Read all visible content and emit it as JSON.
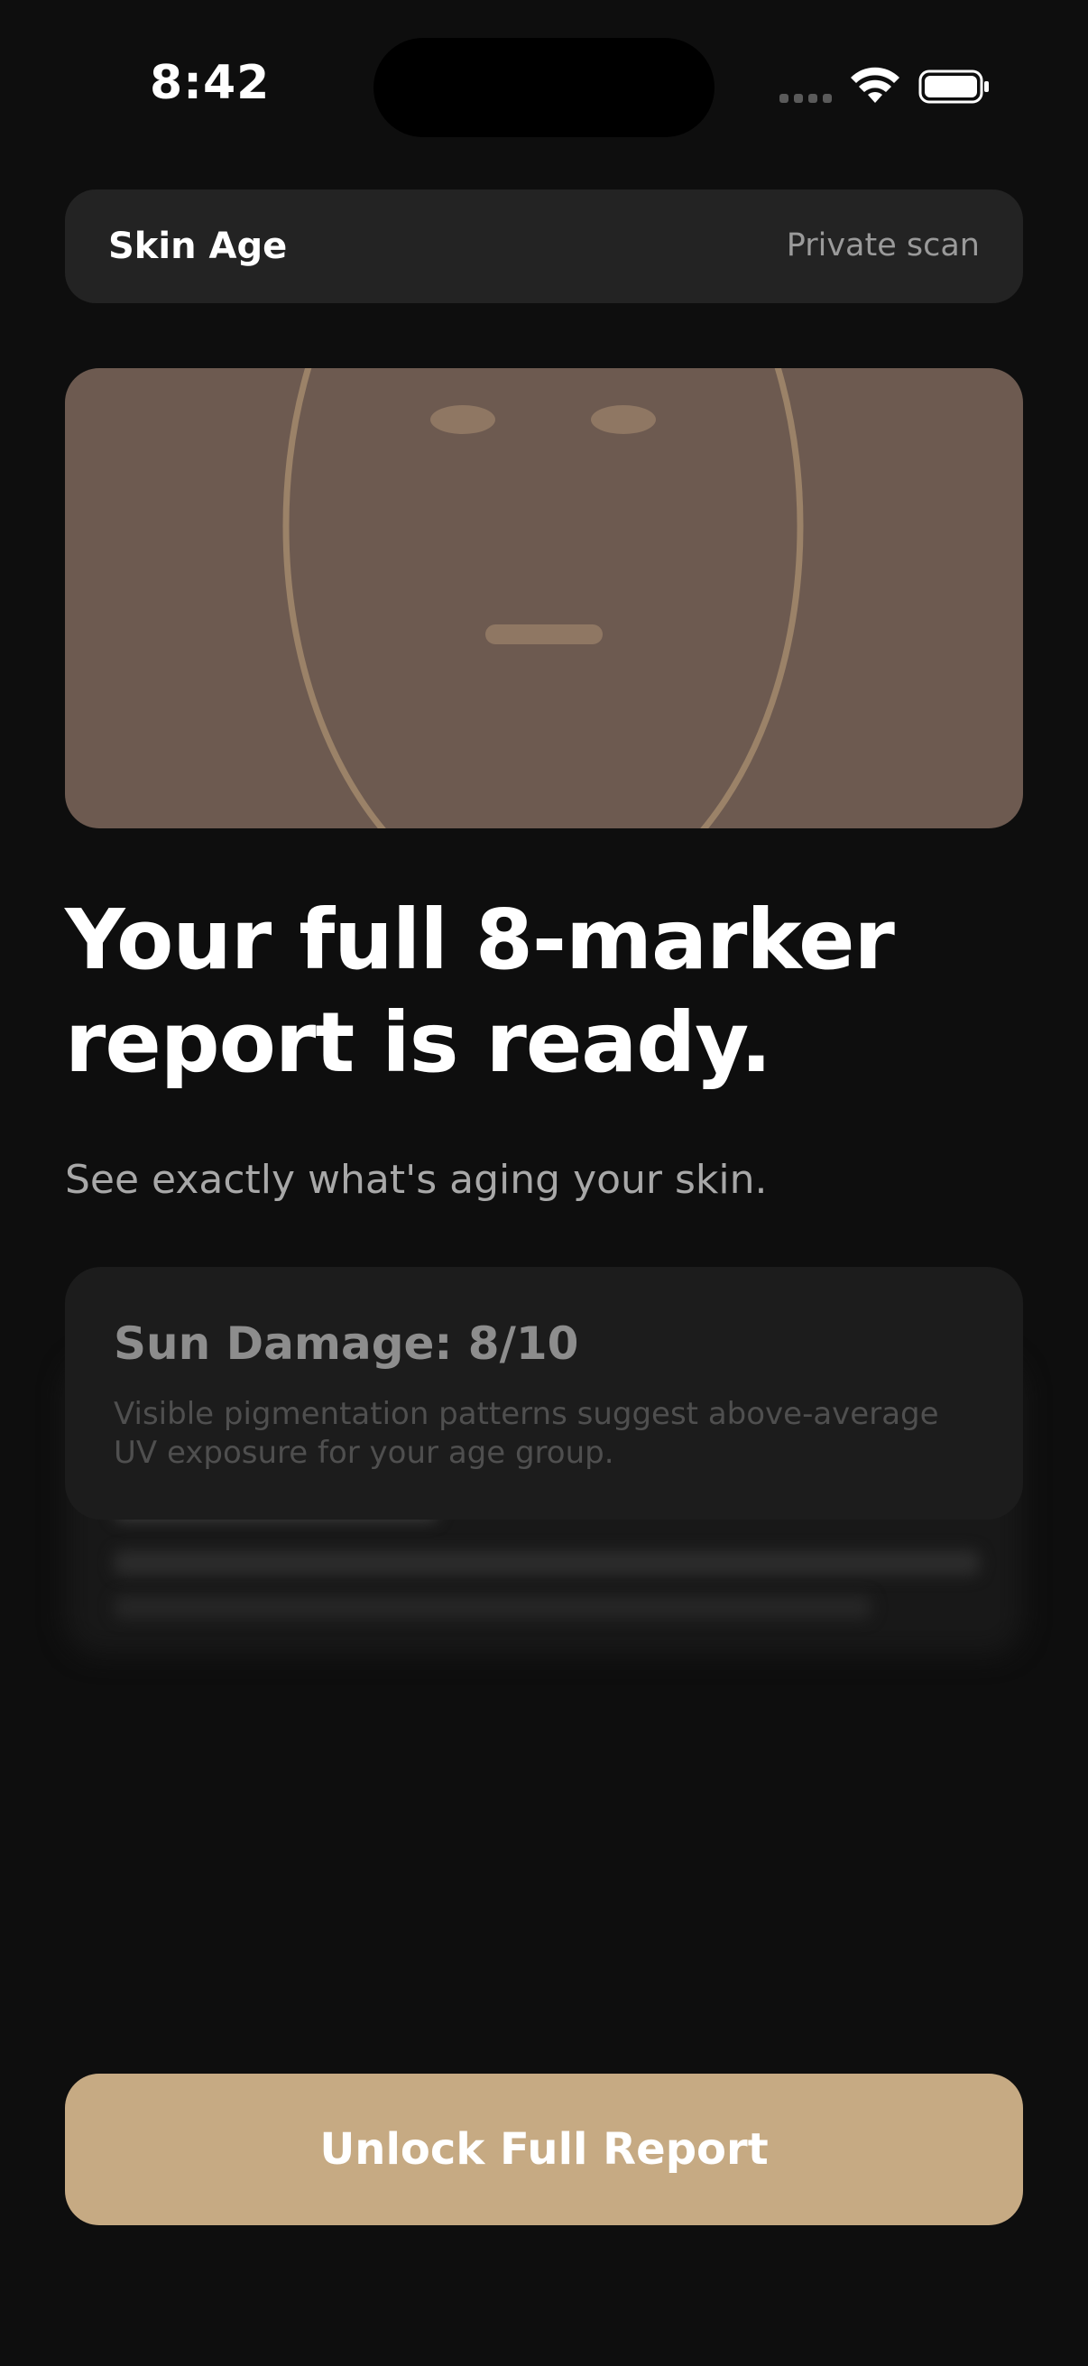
{
  "status_bar": {
    "time": "8:42"
  },
  "header": {
    "title": "Skin Age",
    "subtitle": "Private scan"
  },
  "hero": {
    "headline_line1": "Your full 8-marker",
    "headline_line2": "report is ready.",
    "subheadline": "See exactly what's aging your skin."
  },
  "report_preview": {
    "visible_marker": {
      "title": "Sun Damage: 8/10",
      "description": "Visible pigmentation patterns suggest above-average UV exposure for your age group."
    }
  },
  "cta": {
    "label": "Unlock Full Report"
  },
  "colors": {
    "background": "#0e0e0e",
    "card": "#232323",
    "face_panel": "#6d5a50",
    "face_outline": "#9b8268",
    "accent": "#c6aa83"
  },
  "icons": {
    "wifi": "wifi-icon",
    "battery": "battery-icon",
    "signal": "cellular-signal-icon"
  }
}
